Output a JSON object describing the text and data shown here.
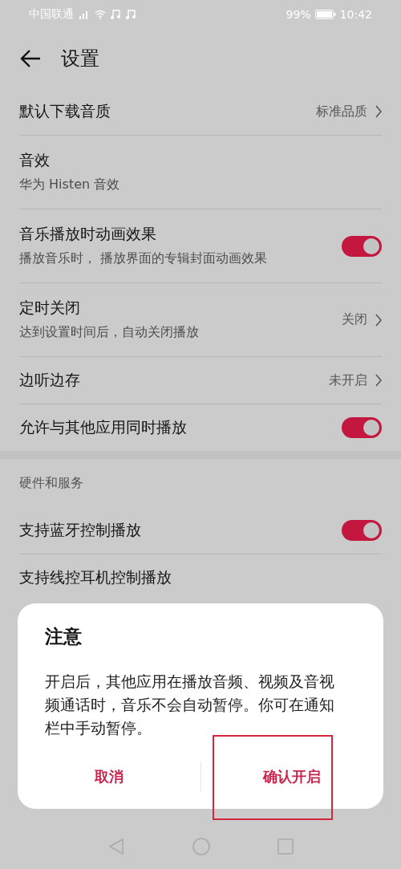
{
  "status_bar": {
    "carrier": "中国联通",
    "battery": "99%",
    "time": "10:42"
  },
  "header": {
    "title": "设置"
  },
  "settings": [
    {
      "kind": "link",
      "title": "默认下载音质",
      "value": "标准品质"
    },
    {
      "kind": "info",
      "title": "音效",
      "subtitle": "华为 Histen 音效"
    },
    {
      "kind": "switch",
      "title": "音乐播放时动画效果",
      "subtitle": "播放音乐时， 播放界面的专辑封面动画效果",
      "on": true
    },
    {
      "kind": "link",
      "title": "定时关闭",
      "subtitle": "达到设置时间后，自动关闭播放",
      "value": "关闭"
    },
    {
      "kind": "link",
      "title": "边听边存",
      "value": "未开启"
    },
    {
      "kind": "switch",
      "title": "允许与其他应用同时播放",
      "on": true
    }
  ],
  "section": {
    "title": "硬件和服务",
    "items": [
      {
        "kind": "switch",
        "title": "支持蓝牙控制播放",
        "on": true
      },
      {
        "kind": "plain",
        "title": "支持线控耳机控制播放"
      }
    ]
  },
  "dialog": {
    "title": "注意",
    "message": "开启后，其他应用在播放音频、视频及音视频通话时，音乐不会自动暂停。你可在通知栏中手动暂停。",
    "buttons": [
      {
        "label": "取消",
        "highlighted": false
      },
      {
        "label": "确认开启",
        "highlighted": true
      }
    ]
  }
}
